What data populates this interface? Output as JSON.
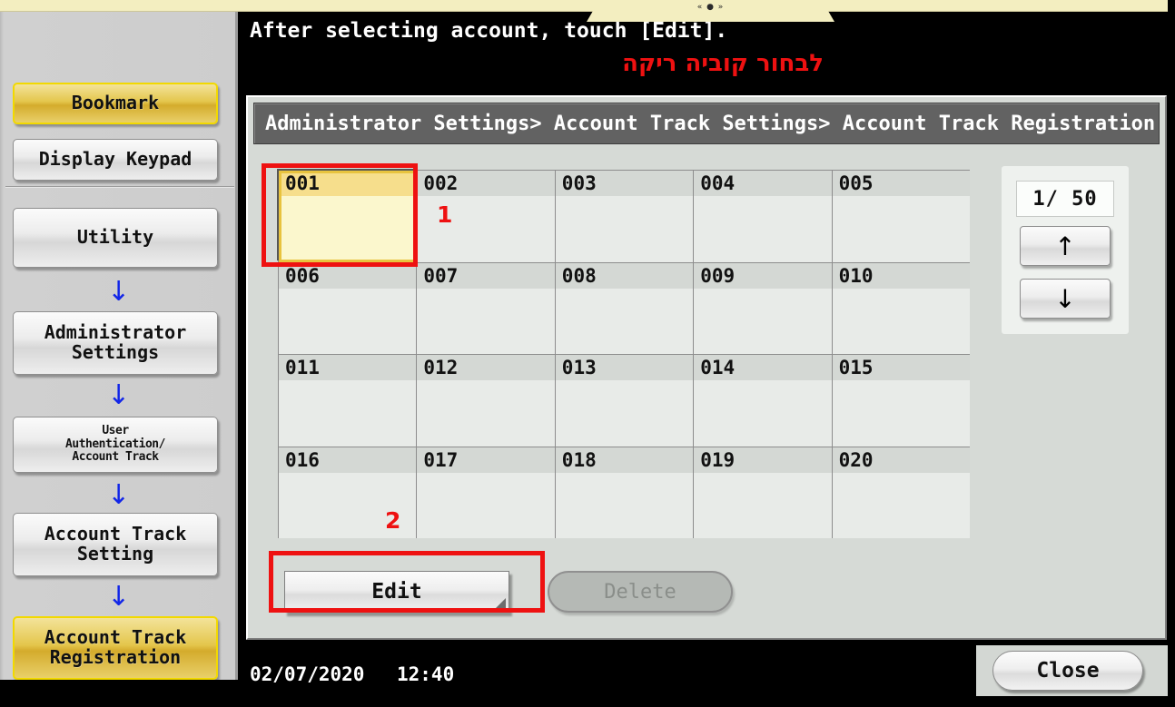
{
  "topbar": {
    "tab_glyph": "« ● »"
  },
  "sidebar": {
    "bookmark_label": "Bookmark",
    "display_keypad_label": "Display Keypad",
    "items": [
      {
        "label": "Utility"
      },
      {
        "label": "Administrator\nSettings"
      },
      {
        "label": "User\nAuthentication/\nAccount Track"
      },
      {
        "label": "Account Track\nSetting"
      },
      {
        "label": "Account Track\nRegistration"
      }
    ],
    "arrow_glyph": "↓"
  },
  "main": {
    "prompt": "After selecting account, touch [Edit].",
    "hebrew_note": "לבחור קוביה ריקה",
    "breadcrumb": "Administrator Settings> Account Track Settings> Account Track Registration",
    "accounts": [
      {
        "id": "001",
        "selected": true
      },
      {
        "id": "002",
        "selected": false
      },
      {
        "id": "003",
        "selected": false
      },
      {
        "id": "004",
        "selected": false
      },
      {
        "id": "005",
        "selected": false
      },
      {
        "id": "006",
        "selected": false
      },
      {
        "id": "007",
        "selected": false
      },
      {
        "id": "008",
        "selected": false
      },
      {
        "id": "009",
        "selected": false
      },
      {
        "id": "010",
        "selected": false
      },
      {
        "id": "011",
        "selected": false
      },
      {
        "id": "012",
        "selected": false
      },
      {
        "id": "013",
        "selected": false
      },
      {
        "id": "014",
        "selected": false
      },
      {
        "id": "015",
        "selected": false
      },
      {
        "id": "016",
        "selected": false
      },
      {
        "id": "017",
        "selected": false
      },
      {
        "id": "018",
        "selected": false
      },
      {
        "id": "019",
        "selected": false
      },
      {
        "id": "020",
        "selected": false
      }
    ],
    "pager": {
      "page_count": "1/ 50",
      "up_glyph": "↑",
      "down_glyph": "↓"
    },
    "edit_label": "Edit",
    "delete_label": "Delete"
  },
  "status": {
    "date": "02/07/2020",
    "time": "12:40",
    "close_label": "Close"
  },
  "annotations": [
    {
      "num": "1"
    },
    {
      "num": "2"
    }
  ],
  "colors": {
    "accent_gold": "#e8c33e",
    "annotation_red": "#ee1111",
    "arrow_blue": "#1226e8",
    "panel_bg": "#d6dad6",
    "breadcrumb_bg": "#626262"
  }
}
